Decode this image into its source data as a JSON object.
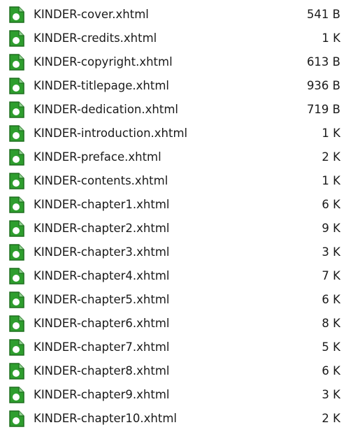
{
  "colors": {
    "icon_fill": "#2e9e2e",
    "icon_border": "#1e6e1e",
    "text": "#1a1a1a",
    "background": "#ffffff"
  },
  "file_icon": "xhtml-file-icon",
  "files": [
    {
      "name": "KINDER-cover.xhtml",
      "size": "541 B"
    },
    {
      "name": "KINDER-credits.xhtml",
      "size": "1 K"
    },
    {
      "name": "KINDER-copyright.xhtml",
      "size": "613 B"
    },
    {
      "name": "KINDER-titlepage.xhtml",
      "size": "936 B"
    },
    {
      "name": "KINDER-dedication.xhtml",
      "size": "719 B"
    },
    {
      "name": "KINDER-introduction.xhtml",
      "size": "1 K"
    },
    {
      "name": "KINDER-preface.xhtml",
      "size": "2 K"
    },
    {
      "name": "KINDER-contents.xhtml",
      "size": "1 K"
    },
    {
      "name": "KINDER-chapter1.xhtml",
      "size": "6 K"
    },
    {
      "name": "KINDER-chapter2.xhtml",
      "size": "9 K"
    },
    {
      "name": "KINDER-chapter3.xhtml",
      "size": "3 K"
    },
    {
      "name": "KINDER-chapter4.xhtml",
      "size": "7 K"
    },
    {
      "name": "KINDER-chapter5.xhtml",
      "size": "6 K"
    },
    {
      "name": "KINDER-chapter6.xhtml",
      "size": "8 K"
    },
    {
      "name": "KINDER-chapter7.xhtml",
      "size": "5 K"
    },
    {
      "name": "KINDER-chapter8.xhtml",
      "size": "6 K"
    },
    {
      "name": "KINDER-chapter9.xhtml",
      "size": "3 K"
    },
    {
      "name": "KINDER-chapter10.xhtml",
      "size": "2 K"
    }
  ]
}
